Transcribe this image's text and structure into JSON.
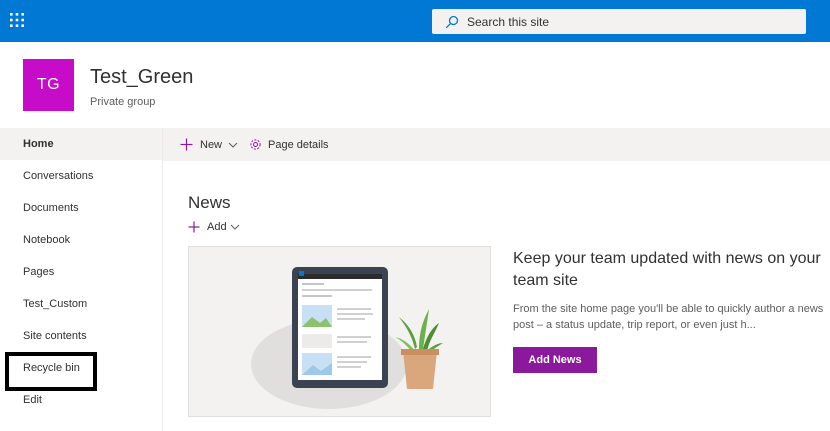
{
  "suitebar": {
    "app_launcher_icon": "waffle-icon",
    "search_placeholder": "Search this site",
    "search_icon": "search-icon",
    "color": "#0078d4"
  },
  "site": {
    "logo_initials": "TG",
    "logo_color": "#c60cc8",
    "title": "Test_Green",
    "subtitle": "Private group"
  },
  "leftnav": {
    "items": [
      {
        "label": "Home",
        "active": true
      },
      {
        "label": "Conversations"
      },
      {
        "label": "Documents"
      },
      {
        "label": "Notebook"
      },
      {
        "label": "Pages"
      },
      {
        "label": "Test_Custom"
      },
      {
        "label": "Site contents"
      },
      {
        "label": "Recycle bin"
      },
      {
        "label": "Edit"
      }
    ]
  },
  "commandbar": {
    "new_label": "New",
    "page_details_label": "Page details"
  },
  "news": {
    "title": "News",
    "add_label": "Add",
    "promo_title": "Keep your team updated with news on your team site",
    "promo_body": "From the site home page you'll be able to quickly author a news post – a status update, trip report, or even just h...",
    "add_news_label": "Add News",
    "accent_color": "#8a1a9b"
  }
}
